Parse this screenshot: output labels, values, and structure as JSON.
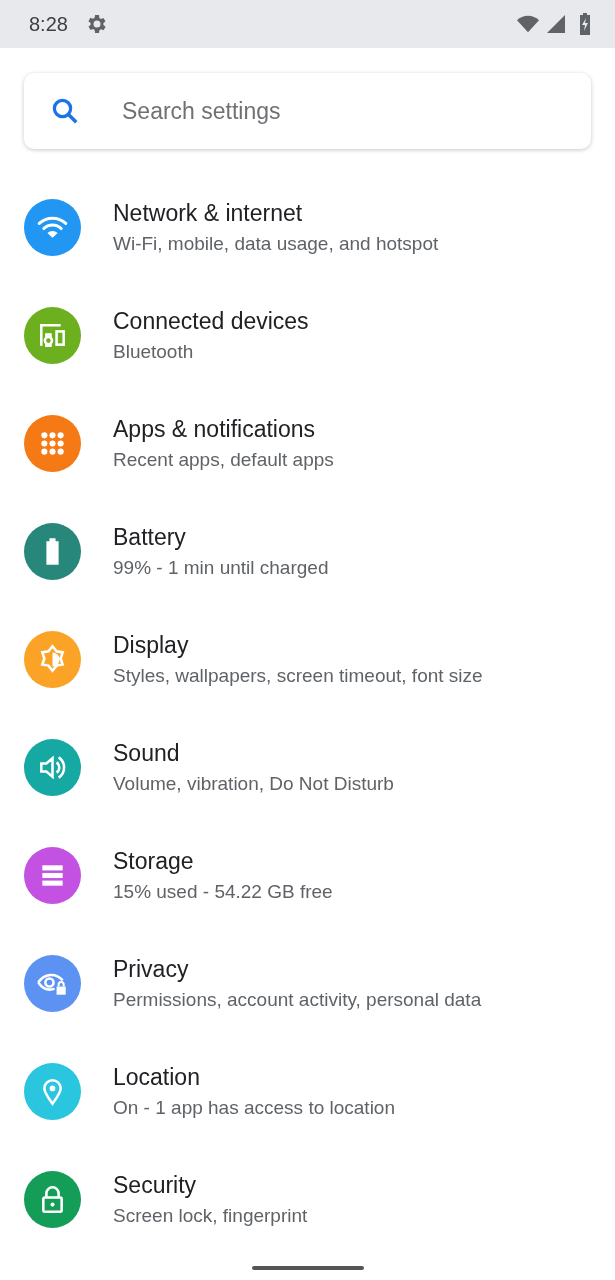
{
  "status_bar": {
    "time": "8:28"
  },
  "search": {
    "placeholder": "Search settings"
  },
  "items": [
    {
      "kind": "wifi",
      "color": "#2196f3",
      "title": "Network & internet",
      "subtitle": "Wi-Fi, mobile, data usage, and hotspot"
    },
    {
      "kind": "devices",
      "color": "#6cb01f",
      "title": "Connected devices",
      "subtitle": "Bluetooth"
    },
    {
      "kind": "apps",
      "color": "#f57a16",
      "title": "Apps & notifications",
      "subtitle": "Recent apps, default apps"
    },
    {
      "kind": "battery",
      "color": "#26877a",
      "title": "Battery",
      "subtitle": "99% - 1 min until charged"
    },
    {
      "kind": "display",
      "color": "#fba327",
      "title": "Display",
      "subtitle": "Styles, wallpapers, screen timeout, font size"
    },
    {
      "kind": "sound",
      "color": "#16a8a3",
      "title": "Sound",
      "subtitle": "Volume, vibration, Do Not Disturb"
    },
    {
      "kind": "storage",
      "color": "#c352e2",
      "title": "Storage",
      "subtitle": "15% used - 54.22 GB free"
    },
    {
      "kind": "privacy",
      "color": "#5c93f3",
      "title": "Privacy",
      "subtitle": "Permissions, account activity, personal data"
    },
    {
      "kind": "location",
      "color": "#2ac5de",
      "title": "Location",
      "subtitle": "On - 1 app has access to location"
    },
    {
      "kind": "security",
      "color": "#149d57",
      "title": "Security",
      "subtitle": "Screen lock, fingerprint"
    }
  ]
}
